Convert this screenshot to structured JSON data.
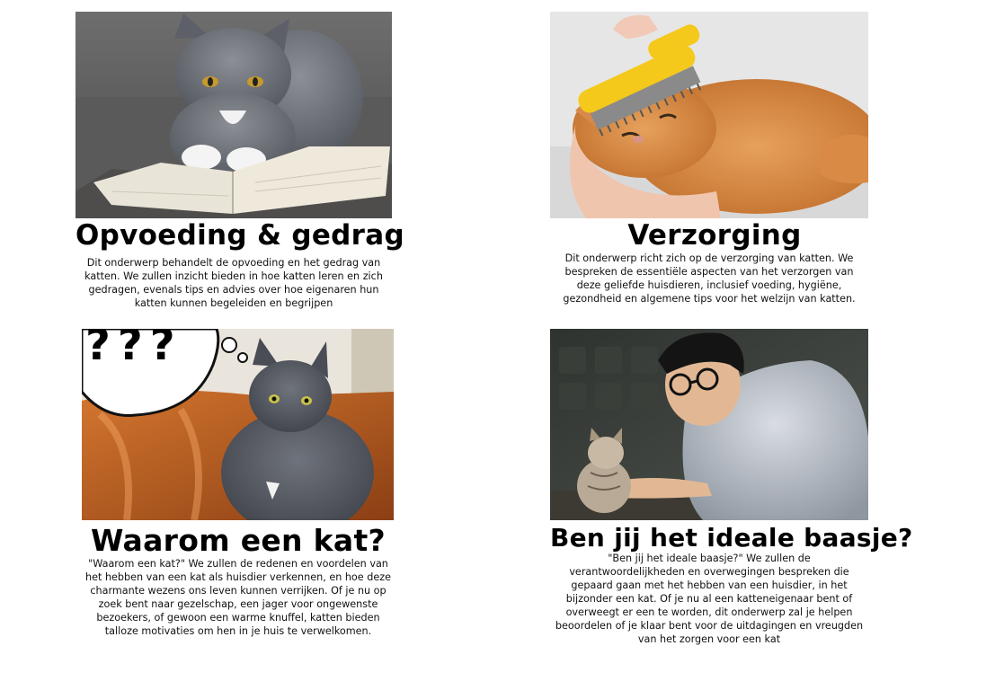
{
  "cards": [
    {
      "title": "Opvoeding & gedrag",
      "description": "Dit onderwerp behandelt de opvoeding en het gedrag van katten. We zullen inzicht bieden in hoe katten leren en zich gedragen, evenals tips en advies over hoe eigenaren hun katten kunnen begeleiden en begrijpen"
    },
    {
      "title": "Verzorging",
      "description": "Dit onderwerp richt zich op de verzorging van katten. We bespreken de essentiële aspecten van het verzorgen van deze geliefde huisdieren, inclusief voeding, hygiëne, gezondheid en algemene tips voor het welzijn van katten."
    },
    {
      "title": "Waarom een kat?",
      "description": "\"Waarom een kat?\" We zullen de redenen en voordelen van het hebben van een kat als huisdier verkennen, en hoe deze charmante wezens ons leven kunnen verrijken. Of je nu op zoek bent naar gezelschap, een jager voor ongewenste bezoekers, of gewoon een warme knuffel, katten bieden talloze motivaties om hen in je huis te verwelkomen."
    },
    {
      "title": "Ben jij het ideale baasje?",
      "description": "\"Ben jij het ideale baasje?\" We zullen de verantwoordelijkheden en overwegingen bespreken die gepaard gaan met het hebben van een huisdier, in het bijzonder een kat. Of je nu al een katteneigenaar bent of overweegt er een te worden, dit onderwerp zal je helpen beoordelen of je klaar bent voor de uitdagingen en vreugden van het zorgen voor een kat"
    }
  ],
  "thought_bubble": "???"
}
